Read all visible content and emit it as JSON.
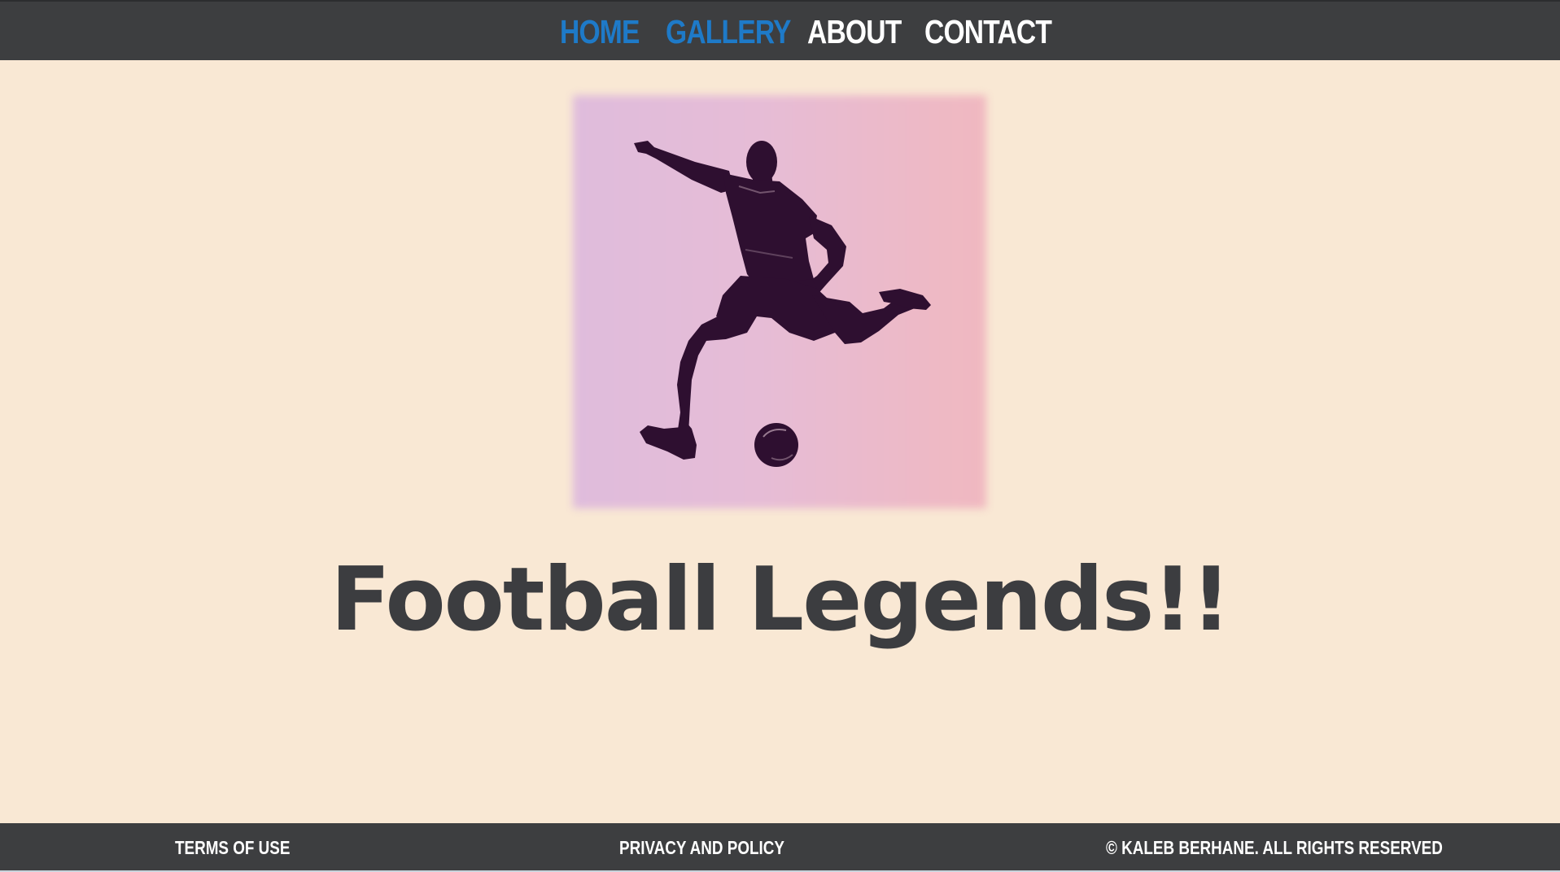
{
  "nav": {
    "items": [
      {
        "label": "HOME",
        "state": "active"
      },
      {
        "label": "GALLERY",
        "state": "active"
      },
      {
        "label": "ABOUT",
        "state": "normal"
      },
      {
        "label": "CONTACT",
        "state": "normal"
      }
    ]
  },
  "hero": {
    "image_icon": "soccer-player-kicking-ball-icon"
  },
  "main": {
    "title": "Football Legends!!"
  },
  "footer": {
    "terms": "TERMS OF USE",
    "privacy": "PRIVACY AND POLICY",
    "copyright": "© KALEB BERHANE. ALL RIGHTS RESERVED"
  },
  "colors": {
    "page_background": "#f9e8d4",
    "bar_background": "#3d3e40",
    "nav_active": "#1e7ac8",
    "nav_inactive": "#ffffff",
    "title_text": "#3c3d40",
    "silhouette": "#2e0f30"
  }
}
